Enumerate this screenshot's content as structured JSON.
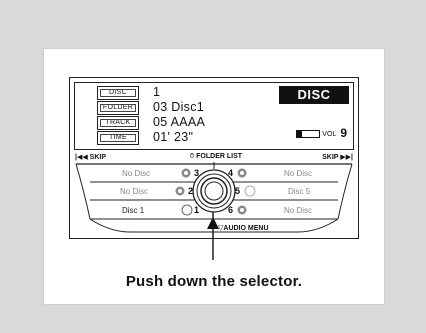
{
  "display": {
    "labels": {
      "disc": "DISC",
      "folder": "FOLDER",
      "track": "TRACK",
      "time": "TIME"
    },
    "values": {
      "disc": "1",
      "folder": "03 Disc1",
      "track": "05 AAAA",
      "time": "01' 23\""
    },
    "mode": "DISC",
    "volume": {
      "label": "VOL",
      "value": "9",
      "level_fraction": 0.2
    }
  },
  "controls": {
    "skip_back": "SKIP",
    "folder_list": "FOLDER LIST",
    "skip_forward": "SKIP",
    "audio_menu": "AUDIO MENU"
  },
  "disc_slots": {
    "left": [
      "No Disc",
      "No Disc",
      "Disc 1"
    ],
    "right": [
      "No Disc",
      "Disc 5",
      "No Disc"
    ]
  },
  "preset_numbers": [
    "3",
    "4",
    "2",
    "5",
    "1",
    "6"
  ],
  "caption": "Push down the selector."
}
